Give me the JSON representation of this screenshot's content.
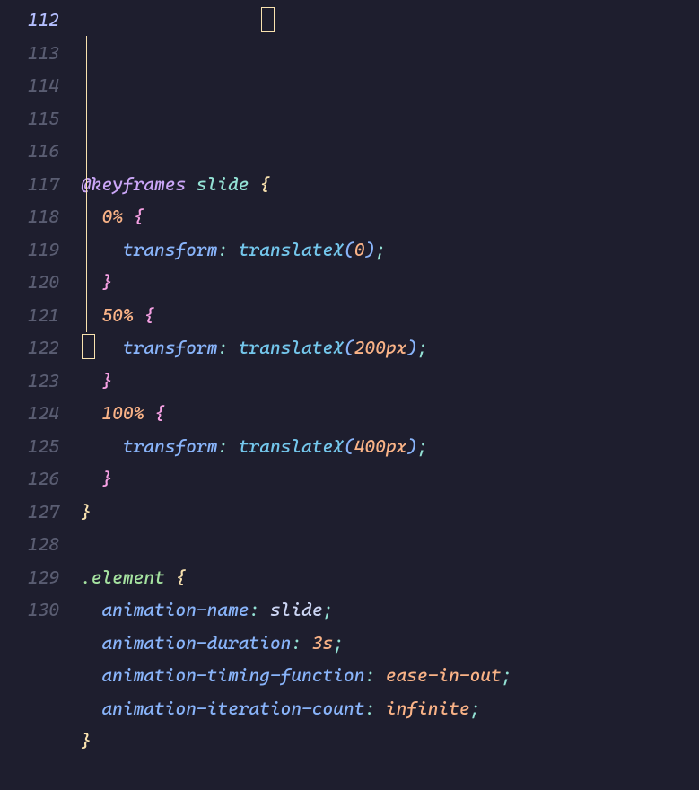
{
  "lineStart": 112,
  "lineCount": 19,
  "activeLine": 112,
  "code": {
    "lines": [
      {
        "indent": 0,
        "tokens": [
          {
            "t": "@keyframes",
            "c": "c-keyword"
          },
          {
            "t": " ",
            "c": "c-white"
          },
          {
            "t": "slide",
            "c": "c-name"
          },
          {
            "t": " ",
            "c": "c-white"
          },
          {
            "t": "{",
            "c": "c-brace-y"
          }
        ]
      },
      {
        "indent": 1,
        "tokens": [
          {
            "t": "0%",
            "c": "c-pct"
          },
          {
            "t": " ",
            "c": "c-white"
          },
          {
            "t": "{",
            "c": "c-brace-m"
          }
        ]
      },
      {
        "indent": 2,
        "tokens": [
          {
            "t": "transform",
            "c": "c-prop"
          },
          {
            "t": ": ",
            "c": "c-punct"
          },
          {
            "t": "translateX",
            "c": "c-func"
          },
          {
            "t": "(",
            "c": "c-brace-b"
          },
          {
            "t": "0",
            "c": "c-num"
          },
          {
            "t": ")",
            "c": "c-brace-b"
          },
          {
            "t": ";",
            "c": "c-punct"
          }
        ]
      },
      {
        "indent": 1,
        "tokens": [
          {
            "t": "}",
            "c": "c-brace-m"
          }
        ]
      },
      {
        "indent": 1,
        "tokens": [
          {
            "t": "50%",
            "c": "c-pct"
          },
          {
            "t": " ",
            "c": "c-white"
          },
          {
            "t": "{",
            "c": "c-brace-m"
          }
        ]
      },
      {
        "indent": 2,
        "tokens": [
          {
            "t": "transform",
            "c": "c-prop"
          },
          {
            "t": ": ",
            "c": "c-punct"
          },
          {
            "t": "translateX",
            "c": "c-func"
          },
          {
            "t": "(",
            "c": "c-brace-b"
          },
          {
            "t": "200px",
            "c": "c-num"
          },
          {
            "t": ")",
            "c": "c-brace-b"
          },
          {
            "t": ";",
            "c": "c-punct"
          }
        ]
      },
      {
        "indent": 1,
        "tokens": [
          {
            "t": "}",
            "c": "c-brace-m"
          }
        ]
      },
      {
        "indent": 1,
        "tokens": [
          {
            "t": "100%",
            "c": "c-pct"
          },
          {
            "t": " ",
            "c": "c-white"
          },
          {
            "t": "{",
            "c": "c-brace-m"
          }
        ]
      },
      {
        "indent": 2,
        "tokens": [
          {
            "t": "transform",
            "c": "c-prop"
          },
          {
            "t": ": ",
            "c": "c-punct"
          },
          {
            "t": "translateX",
            "c": "c-func"
          },
          {
            "t": "(",
            "c": "c-brace-b"
          },
          {
            "t": "400px",
            "c": "c-num"
          },
          {
            "t": ")",
            "c": "c-brace-b"
          },
          {
            "t": ";",
            "c": "c-punct"
          }
        ]
      },
      {
        "indent": 1,
        "tokens": [
          {
            "t": "}",
            "c": "c-brace-m"
          }
        ]
      },
      {
        "indent": 0,
        "tokens": [
          {
            "t": "}",
            "c": "c-brace-y"
          }
        ]
      },
      {
        "indent": 0,
        "tokens": []
      },
      {
        "indent": 0,
        "tokens": [
          {
            "t": ".element",
            "c": "c-selector"
          },
          {
            "t": " ",
            "c": "c-white"
          },
          {
            "t": "{",
            "c": "c-brace-y"
          }
        ]
      },
      {
        "indent": 1,
        "tokens": [
          {
            "t": "animation-name",
            "c": "c-prop"
          },
          {
            "t": ": ",
            "c": "c-punct"
          },
          {
            "t": "slide",
            "c": "c-white"
          },
          {
            "t": ";",
            "c": "c-punct"
          }
        ]
      },
      {
        "indent": 1,
        "tokens": [
          {
            "t": "animation-duration",
            "c": "c-prop"
          },
          {
            "t": ": ",
            "c": "c-punct"
          },
          {
            "t": "3s",
            "c": "c-num"
          },
          {
            "t": ";",
            "c": "c-punct"
          }
        ]
      },
      {
        "indent": 1,
        "tokens": [
          {
            "t": "animation-timing-function",
            "c": "c-prop"
          },
          {
            "t": ": ",
            "c": "c-punct"
          },
          {
            "t": "ease-in-out",
            "c": "c-valident"
          },
          {
            "t": ";",
            "c": "c-punct"
          }
        ]
      },
      {
        "indent": 1,
        "tokens": [
          {
            "t": "animation-iteration-count",
            "c": "c-prop"
          },
          {
            "t": ": ",
            "c": "c-punct"
          },
          {
            "t": "infinite",
            "c": "c-valident"
          },
          {
            "t": ";",
            "c": "c-punct"
          }
        ]
      },
      {
        "indent": 0,
        "tokens": [
          {
            "t": "}",
            "c": "c-brace-y"
          }
        ]
      },
      {
        "indent": 0,
        "tokens": []
      }
    ]
  }
}
